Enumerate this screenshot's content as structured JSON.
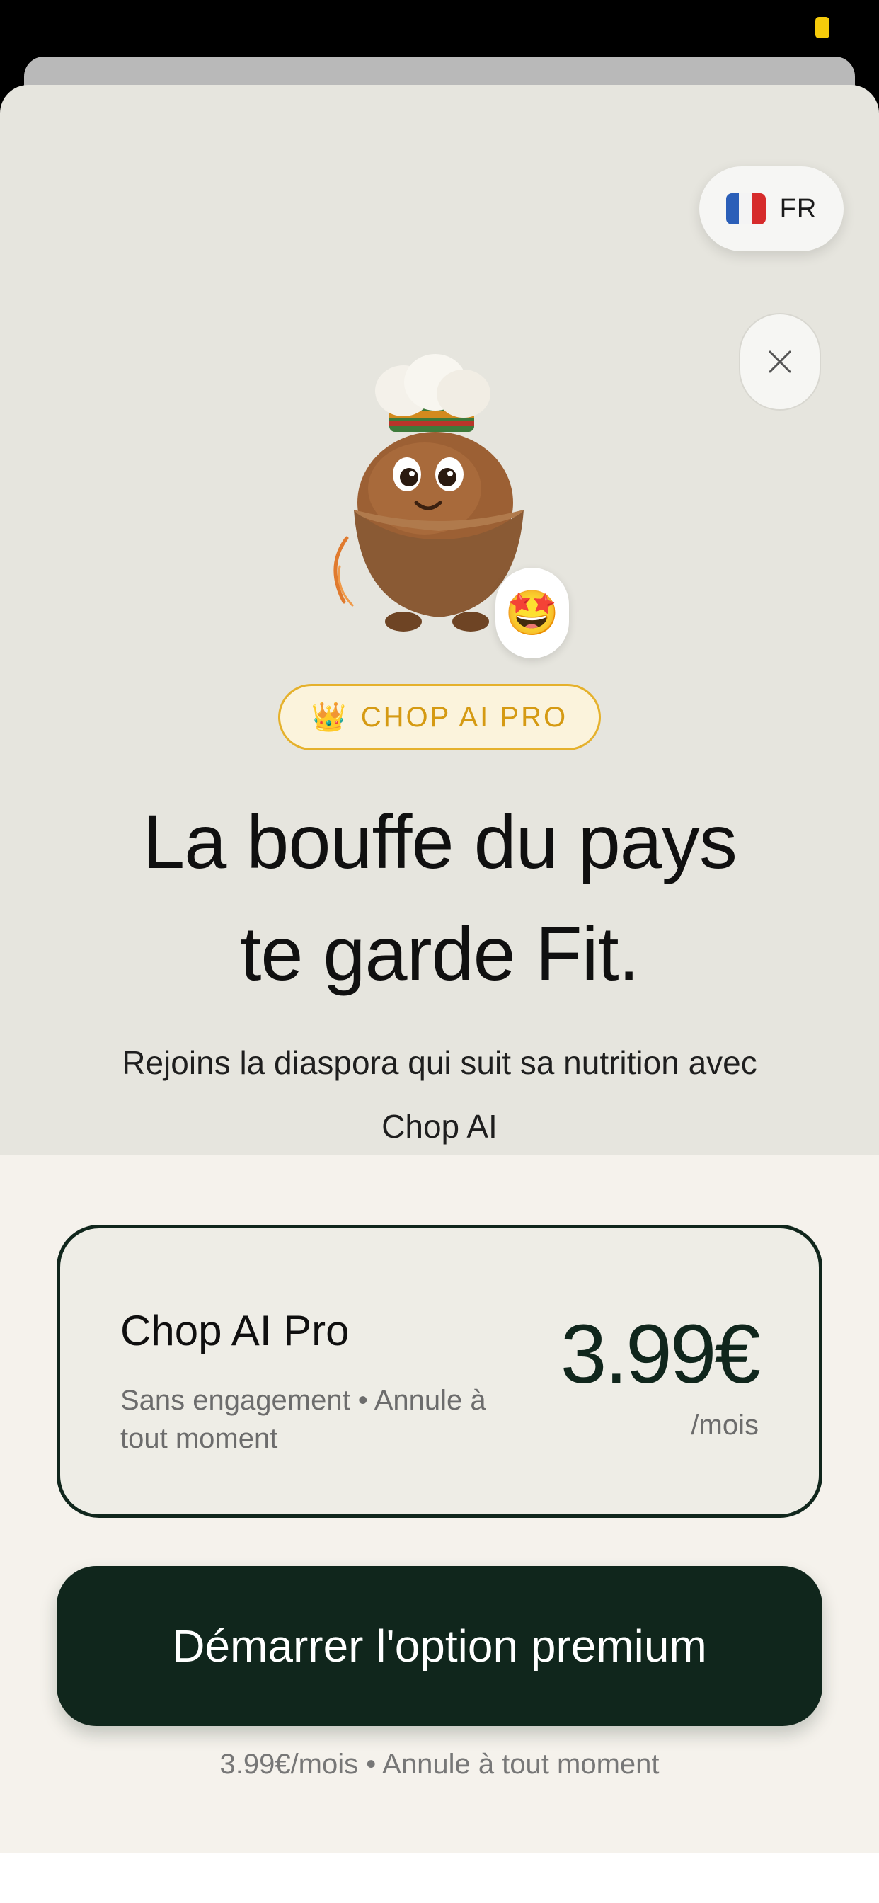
{
  "language": {
    "code": "FR",
    "flag": "french-flag-icon"
  },
  "badge": {
    "icon": "crown-icon",
    "label": "CHOP AI PRO"
  },
  "emoji": "🤩",
  "headline": {
    "line1": "La bouffe du pays",
    "line2": "te garde Fit."
  },
  "subtitle": {
    "line1": "Rejoins la diaspora qui suit sa nutrition avec",
    "line2": "Chop AI"
  },
  "plan": {
    "name": "Chop AI Pro",
    "description": "Sans engagement • Annule à tout moment",
    "price": "3.99€",
    "period": "/mois"
  },
  "cta": {
    "label": "Démarrer l'option premium"
  },
  "footnote": "3.99€/mois • Annule à tout moment",
  "colors": {
    "accent": "#10261c",
    "gold": "#e5b12c",
    "background_top": "#e6e5de",
    "background_bottom": "#f5f2ec"
  }
}
